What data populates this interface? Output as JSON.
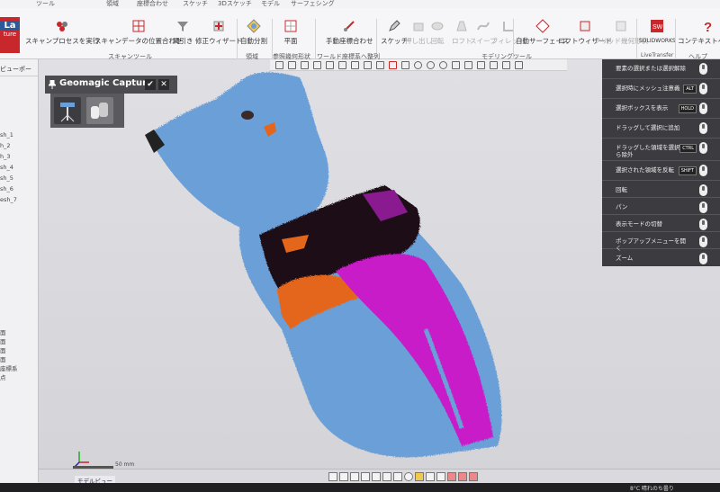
{
  "ribbon": {
    "tabs": [
      "ツール",
      "領域",
      "座標合わせ",
      "スケッチ",
      "3Dスケッチ",
      "モデル",
      "サーフェシング"
    ],
    "app_button": {
      "top": "La",
      "bottom": "ture"
    },
    "tools": {
      "scan_process": "スキャンプロセスを実行",
      "scan_align": "スキャンデータの位置合わせ",
      "subtract": "間引き",
      "fix_wizard": "修正ウィザード",
      "auto_segment": "自動分割",
      "plane": "平面",
      "manual_align": "手動座標合わせ",
      "sketch": "スケッチ",
      "extrude": "押し出し",
      "revolve": "回転",
      "loft": "ロフト",
      "sweep": "スイープ",
      "fillet": "フィレット",
      "auto_surface": "自動サーフェース",
      "loft_wizard": "ロフトウィザード",
      "solid_geom": "ソリッド幾何形状",
      "solidworks": "SOLIDWORKS",
      "content_help": "コンテキストヘルプ"
    },
    "groups": {
      "scan_tools": "スキャンツール",
      "region": "領域",
      "ref_geom": "参照幾何形状",
      "world_align": "ワールド座標系へ整列",
      "modeling_tools": "モデリングツール",
      "live_transfer": "LiveTransfer",
      "help": "ヘルプ"
    }
  },
  "left_panel": {
    "title": "ビューポー",
    "items": [
      "sh_1",
      "h_2",
      "h_3",
      "sh_4",
      "sh_5",
      "sh_6",
      "esh_7"
    ],
    "bottom_items": [
      "面",
      "面",
      "面",
      "面",
      "座標系",
      "点"
    ]
  },
  "plugin": {
    "title": "Geomagic Capture",
    "ok": "✔",
    "close": "✕"
  },
  "hints": [
    {
      "text": "要素の選択または選択解除",
      "key": ""
    },
    {
      "text": "選択時にメッシュ注意義",
      "key": "ALT"
    },
    {
      "text": "選択ボックスを表示",
      "key": "HOLD"
    },
    {
      "text": "ドラッグして選択に追加",
      "key": ""
    },
    {
      "text": "ドラッグした領域を選択から除外",
      "key": "CTRL"
    },
    {
      "text": "選択された領域を反転",
      "key": "SHIFT"
    },
    {
      "text": "回転",
      "key": ""
    },
    {
      "text": "パン",
      "key": ""
    },
    {
      "text": "表示モードの切替",
      "key": ""
    },
    {
      "text": "ポップアップメニューを開く",
      "key": ""
    },
    {
      "text": "ズーム",
      "key": ""
    }
  ],
  "viewport": {
    "scale_label": "50 mm"
  },
  "bottom": {
    "model_tab": "モデルビュー"
  },
  "taskbar": {
    "weather": "8°C 晴れのち曇り"
  },
  "colors": {
    "mesh_blue": "#6a9fd8",
    "deviation_magenta": "#c81ac8",
    "deviation_orange": "#e4661a",
    "hint_panel": "#3c3c40",
    "accent_red": "#c8282b"
  }
}
